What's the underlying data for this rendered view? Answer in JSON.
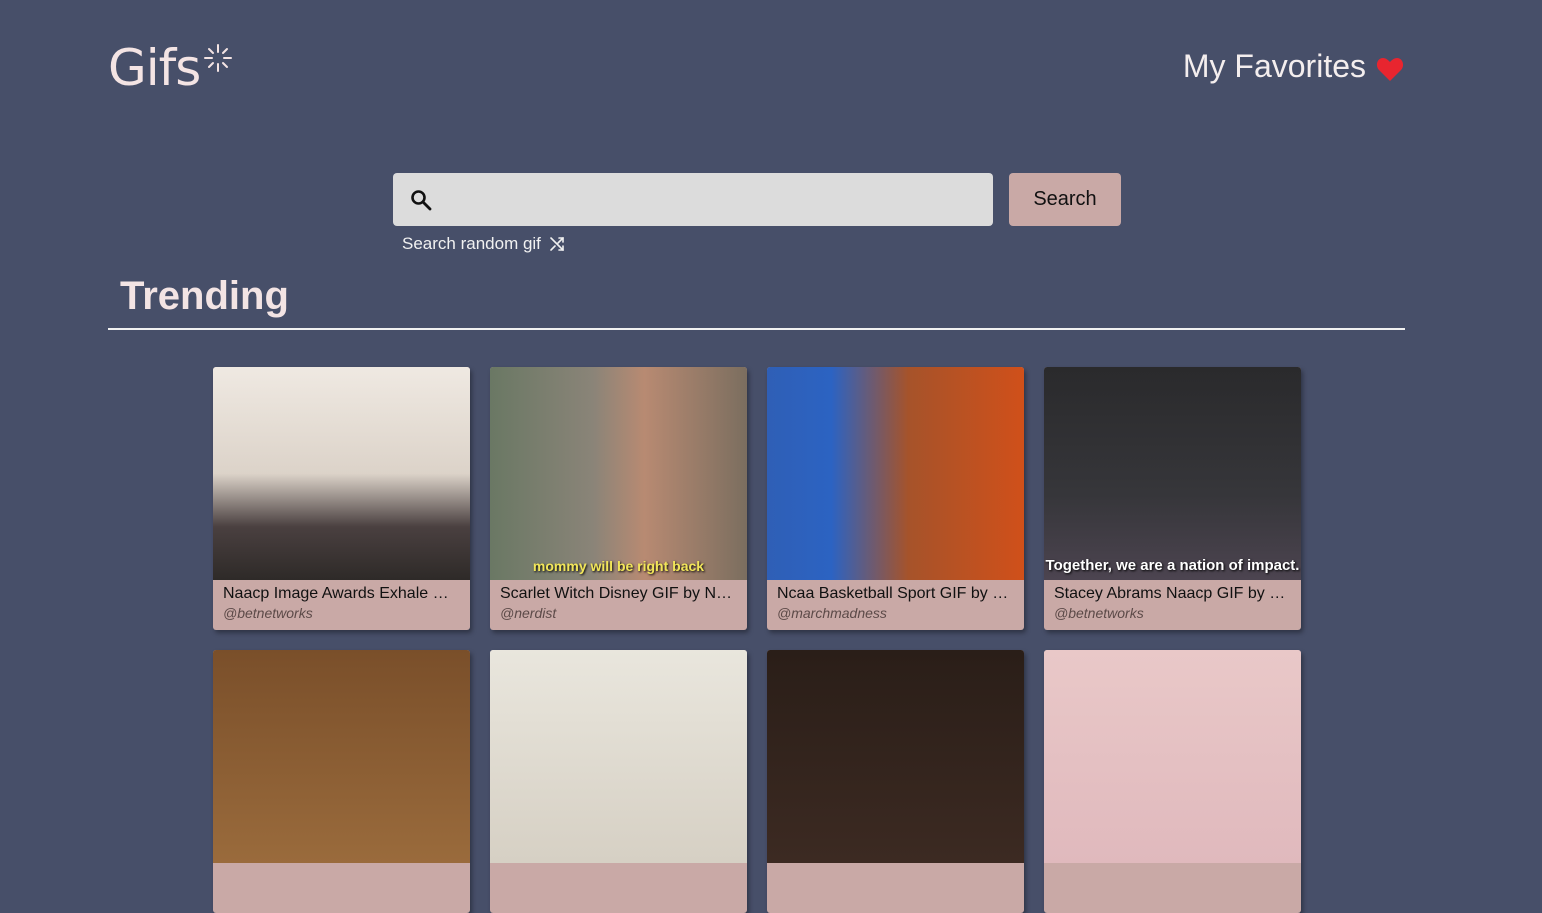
{
  "header": {
    "logo_text": "Gifs",
    "favorites_label": "My Favorites"
  },
  "search": {
    "placeholder": "",
    "value": "",
    "button_label": "Search",
    "random_label": "Search random gif"
  },
  "section": {
    "title": "Trending"
  },
  "cards": [
    {
      "title": "Naacp Image Awards Exhale GIF by BET Networks",
      "user": "@betnetworks",
      "caption": ""
    },
    {
      "title": "Scarlet Witch Disney GIF by Nerdist",
      "user": "@nerdist",
      "caption": "mommy will be right back"
    },
    {
      "title": "Ncaa Basketball Sport GIF by NCAA March Madness",
      "user": "@marchmadness",
      "caption": ""
    },
    {
      "title": "Stacey Abrams Naacp GIF by BET Networks",
      "user": "@betnetworks",
      "caption": "Together, we are a nation of impact."
    }
  ],
  "colors": {
    "background": "#474f69",
    "accent": "#c9a9a6",
    "heart": "#e8252f"
  },
  "icons": {
    "search": "search-icon",
    "shuffle": "shuffle-icon",
    "heart": "heart-icon"
  }
}
